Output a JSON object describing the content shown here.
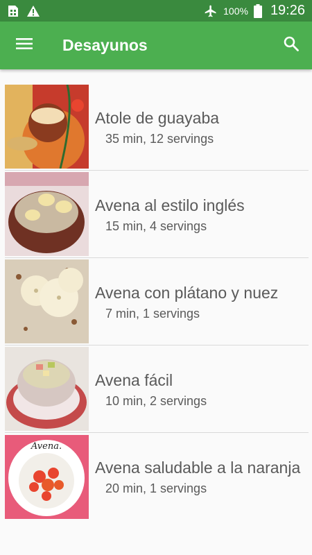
{
  "status_bar": {
    "battery_text": "100%",
    "time": "19:26",
    "icons": [
      "sim-icon",
      "warning-icon",
      "airplane-icon",
      "battery-icon"
    ]
  },
  "app_bar": {
    "title": "Desayunos",
    "menu_icon": "hamburger-menu-icon",
    "search_icon": "search-icon",
    "color": "#4caf50",
    "status_color": "#3a8a3e"
  },
  "recipes": [
    {
      "title": "Atole de guayaba",
      "meta": "35 min, 12 servings"
    },
    {
      "title": "Avena al estilo inglés",
      "meta": "15 min, 4 servings"
    },
    {
      "title": "Avena con plátano y nuez",
      "meta": "7 min, 1 servings"
    },
    {
      "title": "Avena fácil",
      "meta": "10 min, 2 servings"
    },
    {
      "title": "Avena saludable a la naranja",
      "meta": "20 min, 1 servings"
    }
  ]
}
